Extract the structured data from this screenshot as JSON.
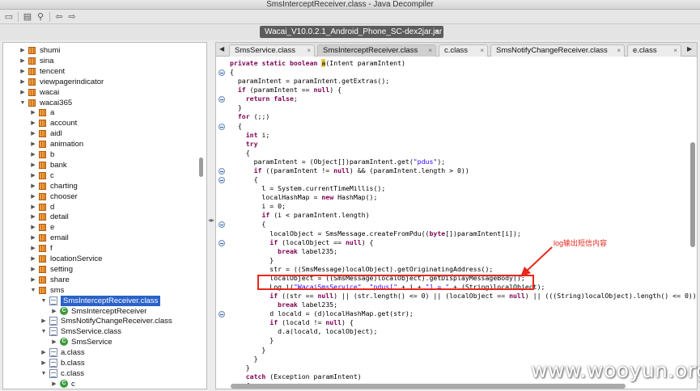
{
  "window": {
    "title": "SmsInterceptReceiver.class - Java Decompiler"
  },
  "toolbar": {
    "icons": [
      "open-folder-icon",
      "open-file-icon",
      "search-icon",
      "back-icon",
      "forward-icon"
    ]
  },
  "file_tab": {
    "label": "Wacai_V10.0.2.1_Android_Phone_SC-dex2jar.jar",
    "close": "×"
  },
  "tree": {
    "items": [
      {
        "label": "shumi",
        "kind": "package",
        "tri": "▶"
      },
      {
        "label": "sina",
        "kind": "package",
        "tri": "▶"
      },
      {
        "label": "tencent",
        "kind": "package",
        "tri": "▶"
      },
      {
        "label": "viewpagerindicator",
        "kind": "package",
        "tri": "▶"
      },
      {
        "label": "wacai",
        "kind": "package",
        "tri": "▶"
      },
      {
        "label": "wacai365",
        "kind": "package",
        "tri": "▼"
      },
      {
        "label": "a",
        "kind": "package",
        "tri": "▶"
      },
      {
        "label": "account",
        "kind": "package",
        "tri": "▶"
      },
      {
        "label": "aidl",
        "kind": "package",
        "tri": "▶"
      },
      {
        "label": "animation",
        "kind": "package",
        "tri": "▶"
      },
      {
        "label": "b",
        "kind": "package",
        "tri": "▶"
      },
      {
        "label": "bank",
        "kind": "package",
        "tri": "▶"
      },
      {
        "label": "c",
        "kind": "package",
        "tri": "▶"
      },
      {
        "label": "charting",
        "kind": "package",
        "tri": "▶"
      },
      {
        "label": "chooser",
        "kind": "package",
        "tri": "▶"
      },
      {
        "label": "d",
        "kind": "package",
        "tri": "▶"
      },
      {
        "label": "detail",
        "kind": "package",
        "tri": "▶"
      },
      {
        "label": "e",
        "kind": "package",
        "tri": "▶"
      },
      {
        "label": "email",
        "kind": "package",
        "tri": "▶"
      },
      {
        "label": "f",
        "kind": "package",
        "tri": "▶"
      },
      {
        "label": "locationService",
        "kind": "package",
        "tri": "▶"
      },
      {
        "label": "setting",
        "kind": "package",
        "tri": "▶"
      },
      {
        "label": "share",
        "kind": "package",
        "tri": "▶"
      },
      {
        "label": "sms",
        "kind": "package",
        "tri": "▼"
      },
      {
        "label": "SmsInterceptReceiver.class",
        "kind": "file",
        "tri": "▼",
        "selected": true
      },
      {
        "label": "SmsInterceptReceiver",
        "kind": "class",
        "tri": "▶",
        "badge": "C"
      },
      {
        "label": "SmsNotifyChangeReceiver.class",
        "kind": "file",
        "tri": "▶"
      },
      {
        "label": "SmsService.class",
        "kind": "file",
        "tri": "▼"
      },
      {
        "label": "SmsService",
        "kind": "class",
        "tri": "▶",
        "badge": "C"
      },
      {
        "label": "a.class",
        "kind": "file",
        "tri": "▶"
      },
      {
        "label": "b.class",
        "kind": "file",
        "tri": "▶"
      },
      {
        "label": "c.class",
        "kind": "file",
        "tri": "▼"
      },
      {
        "label": "c",
        "kind": "class",
        "tri": "▶",
        "badge": "C"
      }
    ]
  },
  "editor": {
    "tabs": [
      {
        "label": "SmsService.class",
        "active": false
      },
      {
        "label": "SmsInterceptReceiver.class",
        "active": true
      },
      {
        "label": "c.class",
        "active": false
      },
      {
        "label": "SmsNotifyChangeReceiver.class",
        "active": false
      },
      {
        "label": "e.class",
        "active": false
      }
    ],
    "tab_close": "×",
    "code": [
      "private static boolean a(Intent paramIntent)",
      "{",
      "  paramIntent = paramIntent.getExtras();",
      "  if (paramIntent == null) {",
      "    return false;",
      "  }",
      "  for (;;)",
      "  {",
      "    int i;",
      "    try",
      "    {",
      "      paramIntent = (Object[])paramIntent.get(\"pdus\");",
      "      if ((paramIntent != null) && (paramIntent.length > 0))",
      "      {",
      "        l = System.currentTimeMillis();",
      "        localHashMap = new HashMap();",
      "        i = 0;",
      "        if (i < paramIntent.length)",
      "        {",
      "          localObject = SmsMessage.createFromPdu((byte[])paramIntent[i]);",
      "          if (localObject == null) {",
      "            break label235;",
      "          }",
      "          str = ((SmsMessage)localObject).getOriginatingAddress();",
      "          localObject = ((SmsMessage)localObject).getDisplayMessageBody();",
      "          Log.i(\"WacaiSmsService\", \"pdus[\" + i + \"] = \" + (String)localObject);",
      "          if ((str == null) || (str.length() <= 0) || (localObject == null) || (((String)localObject).length() <= 0))",
      "            break label235;",
      "          d locald = (d)localHashMap.get(str);",
      "          if (locald != null) {",
      "            d.a(locald, localObject);",
      "          }",
      "        }",
      "      }",
      "    }",
      "    catch (Exception paramIntent)",
      "    {"
    ]
  },
  "annotation": {
    "text": "log输出短信内容",
    "color": "#e8271c"
  },
  "watermark": {
    "text": "www.wooyun.org"
  }
}
